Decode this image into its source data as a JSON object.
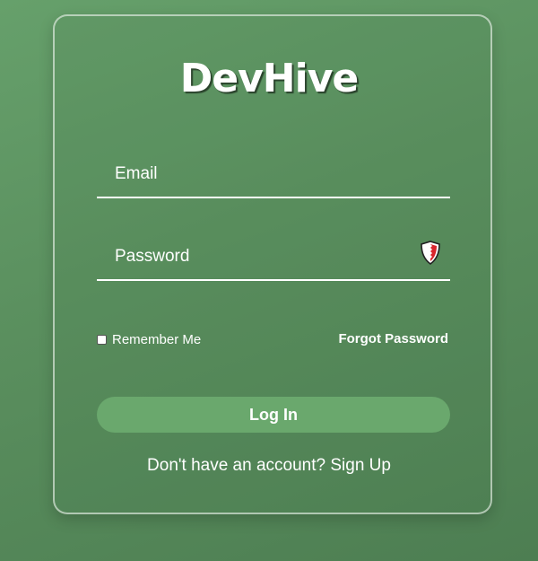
{
  "app": {
    "title": "DevHive"
  },
  "form": {
    "email": {
      "placeholder": "Email",
      "value": ""
    },
    "password": {
      "placeholder": "Password",
      "value": "",
      "icon": "password-manager-shield-icon"
    },
    "remember_label": "Remember Me",
    "remember_checked": false,
    "forgot_label": "Forgot Password",
    "login_label": "Log In",
    "signup_prompt": "Don't have an account?",
    "signup_link": "Sign Up"
  },
  "colors": {
    "background_top": "#66a06b",
    "background_bottom": "#4d7e52",
    "button": "#6aa86d",
    "text": "#ffffff"
  }
}
